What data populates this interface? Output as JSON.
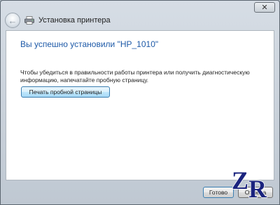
{
  "window": {
    "title": "Установка принтера",
    "close_symbol": "✕"
  },
  "content": {
    "heading": "Вы успешно установили \"HP_1010\"",
    "description": "Чтобы убедиться в правильности работы принтера или получить диагностическую информацию, напечатайте пробную страницу.",
    "test_page_button": "Печать пробной страницы"
  },
  "footer": {
    "done_button": "Готово",
    "cancel_button": "Отмена"
  },
  "watermark": {
    "text": "ZR"
  },
  "icons": {
    "back": "back-arrow-icon",
    "printer": "printer-icon",
    "close": "close-icon"
  },
  "colors": {
    "heading": "#1e5aa8",
    "accent_button_border": "#3c7fb1",
    "watermark": "#1a237e"
  }
}
